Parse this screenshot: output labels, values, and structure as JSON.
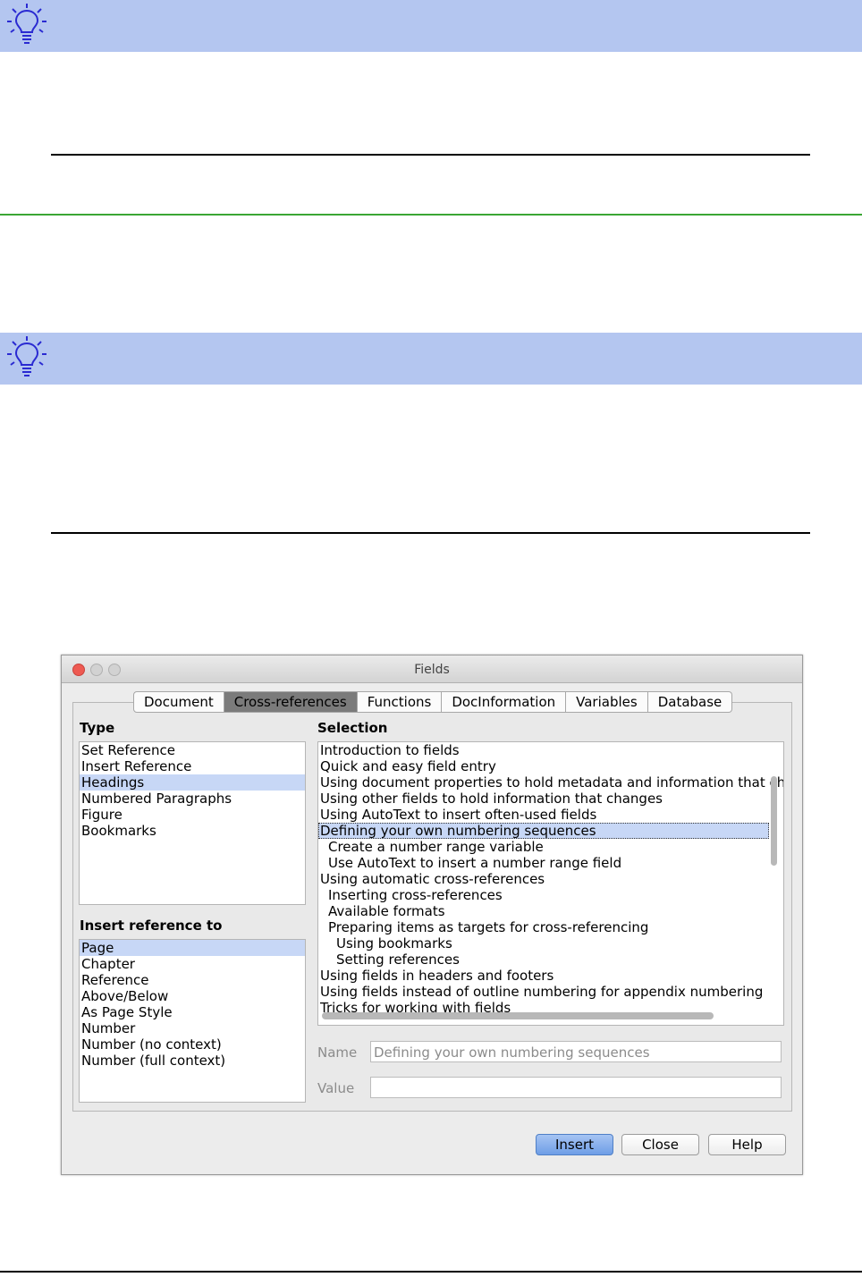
{
  "dialog": {
    "title": "Fields",
    "tabs": [
      "Document",
      "Cross-references",
      "Functions",
      "DocInformation",
      "Variables",
      "Database"
    ],
    "type_label": "Type",
    "type_items": [
      "Set Reference",
      "Insert Reference",
      "Headings",
      "Numbered Paragraphs",
      "Figure",
      "Bookmarks"
    ],
    "selected_type": "Headings",
    "insert_label": "Insert reference to",
    "insert_items": [
      "Page",
      "Chapter",
      "Reference",
      "Above/Below",
      "As Page Style",
      "Number",
      "Number (no context)",
      "Number (full context)"
    ],
    "selected_insert": "Page",
    "selection_label": "Selection",
    "selection_items": [
      "Introduction to fields",
      "Quick and easy field entry",
      "Using document properties to hold metadata and information that ch",
      "Using other fields to hold information that changes",
      "Using AutoText to insert often-used fields",
      "Defining your own numbering sequences",
      "Create a number range variable",
      "Use AutoText to insert a number range field",
      "Using automatic cross-references",
      "Inserting cross-references",
      "Available formats",
      "Preparing items as targets for cross-referencing",
      "Using bookmarks",
      "Setting references",
      "Using fields in headers and footers",
      "Using fields instead of outline numbering for appendix numbering",
      "Tricks for working with fields"
    ],
    "selected_selection": "Defining your own numbering sequences",
    "name_label": "Name",
    "name_value": "Defining your own numbering sequences",
    "value_label": "Value",
    "value_value": "",
    "insert_button": "Insert",
    "close_button": "Close",
    "help_button": "Help"
  },
  "colors": {
    "tip_bar": "#b4c6f0",
    "tip_icon": "#2a2ad2",
    "green_rule": "#3aa634",
    "selection_highlight": "#c7d7f6"
  }
}
